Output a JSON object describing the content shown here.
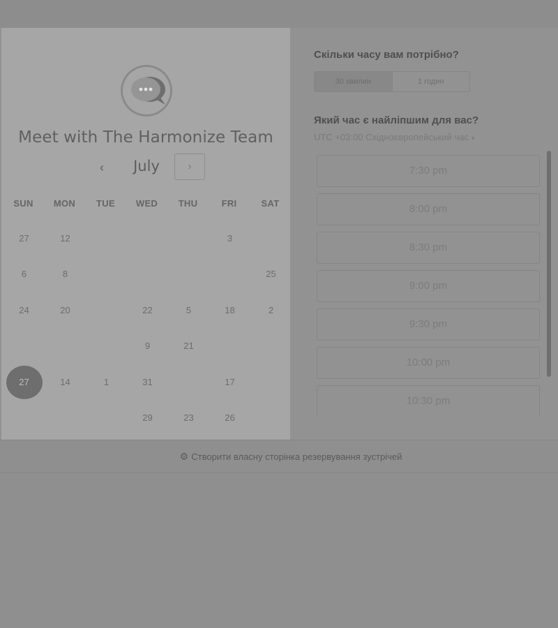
{
  "calendar": {
    "title": "Meet with The Harmonize Team",
    "month": "July",
    "prev_icon": "‹",
    "next_icon": "›",
    "weekdays": [
      "SUN",
      "MON",
      "TUE",
      "WED",
      "THU",
      "FRI",
      "SAT"
    ],
    "days": [
      {
        "label": "27",
        "col": 0,
        "row": 0
      },
      {
        "label": "12",
        "col": 1,
        "row": 0
      },
      {
        "label": "3",
        "col": 5,
        "row": 0
      },
      {
        "label": "6",
        "col": 0,
        "row": 1
      },
      {
        "label": "8",
        "col": 1,
        "row": 1
      },
      {
        "label": "25",
        "col": 6,
        "row": 1
      },
      {
        "label": "24",
        "col": 0,
        "row": 2
      },
      {
        "label": "20",
        "col": 1,
        "row": 2
      },
      {
        "label": "22",
        "col": 3,
        "row": 2
      },
      {
        "label": "5",
        "col": 4,
        "row": 2
      },
      {
        "label": "18",
        "col": 5,
        "row": 2
      },
      {
        "label": "2",
        "col": 6,
        "row": 2
      },
      {
        "label": "9",
        "col": 3,
        "row": 3
      },
      {
        "label": "21",
        "col": 4,
        "row": 3
      },
      {
        "label": "27",
        "col": 0,
        "row": 4,
        "selected": true
      },
      {
        "label": "14",
        "col": 1,
        "row": 4
      },
      {
        "label": "1",
        "col": 2,
        "row": 4
      },
      {
        "label": "31",
        "col": 3,
        "row": 4
      },
      {
        "label": "17",
        "col": 5,
        "row": 4
      },
      {
        "label": "29",
        "col": 3,
        "row": 5
      },
      {
        "label": "23",
        "col": 4,
        "row": 5
      },
      {
        "label": "26",
        "col": 5,
        "row": 5
      }
    ]
  },
  "scheduler": {
    "duration_question": "Скільки часу вам потрібно?",
    "durations": [
      {
        "label": "30 хвилин",
        "active": true
      },
      {
        "label": "1 годин",
        "active": false
      }
    ],
    "time_question": "Який час є найліпшим для вас?",
    "timezone": "UTC +03:00 Східноєвропейський час",
    "timezone_caret": "▾",
    "slots": [
      "7:30 pm",
      "8:00 pm",
      "8:30 pm",
      "9:00 pm",
      "9:30 pm",
      "10:00 pm",
      "10:30 pm"
    ]
  },
  "footer": {
    "icon": "sprocket-icon",
    "icon_glyph": "⚙",
    "link_text": "Створити власну сторінка резервування зустрічей"
  }
}
